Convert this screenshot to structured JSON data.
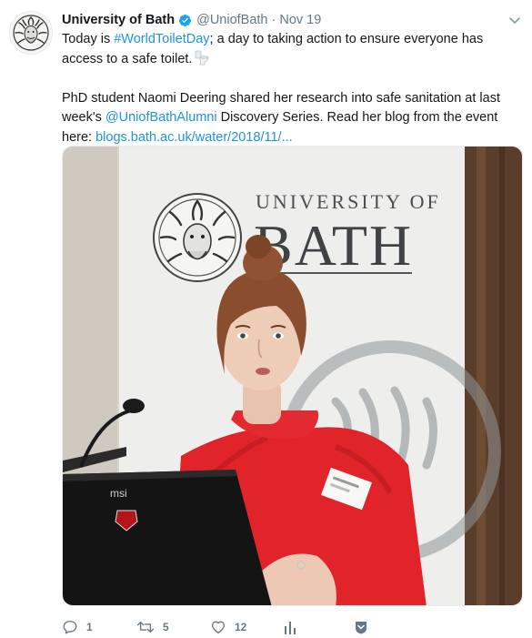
{
  "tweet": {
    "display_name": "University of Bath",
    "handle": "@UniofBath",
    "separator": "·",
    "time": "Nov 19",
    "line1": {
      "pre": "Today is ",
      "hashtag": "#WorldToiletDay",
      "post": "; a day to taking action to ensure everyone has access to a safe toilet."
    },
    "line2": {
      "pre": "PhD student Naomi Deering shared her research into safe sanitation at last week's ",
      "mention": "@UniofBathAlumni",
      "post": " Discovery Series. Read her blog from the event here: ",
      "url": "blogs.bath.ac.uk/water/2018/11/..."
    },
    "photo": {
      "banner_line1": "UNIVERSITY OF",
      "banner_line2": "BATH",
      "laptop_brand": "msi"
    },
    "actions": {
      "replies": "1",
      "retweets": "5",
      "likes": "12"
    }
  },
  "icons": {
    "avatar": "university-crest-icon",
    "verified": "verified-badge-icon",
    "menu": "chevron-down-icon",
    "toilet": "toilet-emoji-icon",
    "reply": "reply-icon",
    "retweet": "retweet-icon",
    "like": "heart-icon",
    "analytics": "analytics-icon",
    "dm": "direct-message-icon"
  },
  "colors": {
    "link": "#1c94e0",
    "verified": "#1da1f2",
    "muted": "#657786",
    "text": "#14171a",
    "sweater": "#e0242a"
  }
}
